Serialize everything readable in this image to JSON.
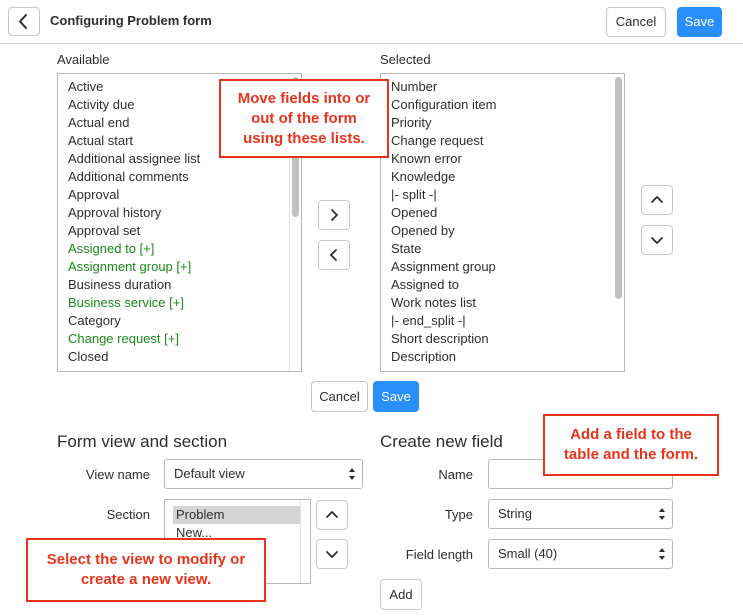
{
  "header": {
    "title": "Configuring Problem form",
    "cancel_label": "Cancel",
    "save_label": "Save"
  },
  "slush": {
    "available_label": "Available",
    "selected_label": "Selected",
    "available_items": [
      {
        "label": "Active",
        "reference": false
      },
      {
        "label": "Activity due",
        "reference": false
      },
      {
        "label": "Actual end",
        "reference": false
      },
      {
        "label": "Actual start",
        "reference": false
      },
      {
        "label": "Additional assignee list",
        "reference": false
      },
      {
        "label": "Additional comments",
        "reference": false
      },
      {
        "label": "Approval",
        "reference": false
      },
      {
        "label": "Approval history",
        "reference": false
      },
      {
        "label": "Approval set",
        "reference": false
      },
      {
        "label": "Assigned to [+]",
        "reference": true
      },
      {
        "label": "Assignment group [+]",
        "reference": true
      },
      {
        "label": "Business duration",
        "reference": false
      },
      {
        "label": "Business service [+]",
        "reference": true
      },
      {
        "label": "Category",
        "reference": false
      },
      {
        "label": "Change request [+]",
        "reference": true
      },
      {
        "label": "Closed",
        "reference": false
      }
    ],
    "selected_items": [
      "Number",
      "Configuration item",
      "Priority",
      "Change request",
      "Known error",
      "Knowledge",
      "|- split -|",
      "Opened",
      "Opened by",
      "State",
      "Assignment group",
      "Assigned to",
      "Work notes list",
      "|- end_split -|",
      "Short description",
      "Description"
    ],
    "cancel_label": "Cancel",
    "save_label": "Save"
  },
  "form_view": {
    "heading": "Form view and section",
    "view_name_label": "View name",
    "view_name_value": "Default view",
    "section_label": "Section",
    "sections": [
      "Problem",
      "New..."
    ],
    "selected_section": "Problem"
  },
  "new_field": {
    "heading": "Create new field",
    "name_label": "Name",
    "name_value": "",
    "type_label": "Type",
    "type_value": "String",
    "length_label": "Field length",
    "length_value": "Small (40)",
    "add_label": "Add"
  },
  "callouts": {
    "lists": "Move fields into or out of the form using these lists.",
    "add_field": "Add a field to the table and the form.",
    "view": "Select the view to modify or create a new view."
  },
  "colors": {
    "primary": "#278efc",
    "reference_field": "#1a8a1a",
    "callout": "#e8341c"
  }
}
